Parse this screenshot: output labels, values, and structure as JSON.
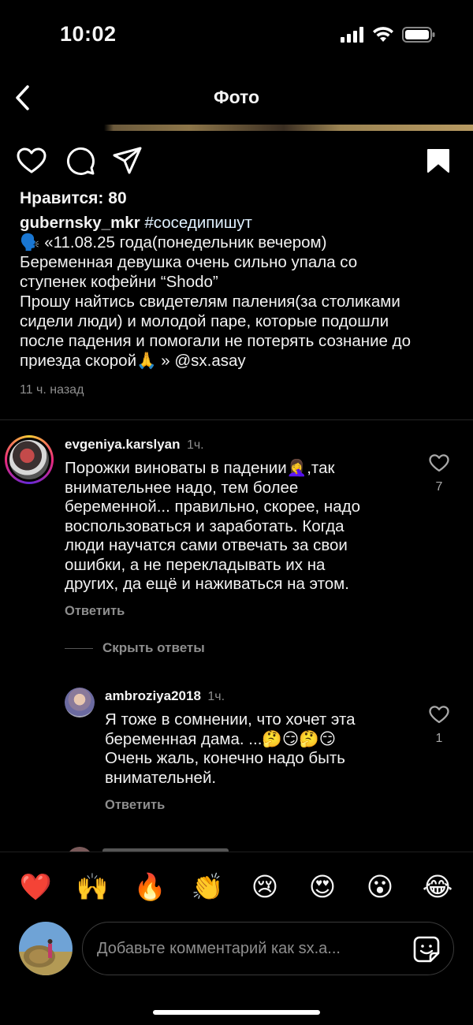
{
  "status_bar": {
    "time": "10:02"
  },
  "nav": {
    "title": "Фото"
  },
  "post": {
    "likes_text": "Нравится: 80",
    "caption": {
      "username": "gubernsky_mkr",
      "hashtag": "#соседипишут",
      "lines": [
        "🗣️ «11.08.25 года(понедельник вечером)",
        "Беременная девушка очень сильно упала со",
        "ступенек кофейни “Shodo”",
        "Прошу найтись свидетелям паления(за столиками",
        "сидели люди) и молодой паре, которые подошли",
        "после падения и помогали не потерять сознание до",
        "приезда скорой🙏 » @sx.asay"
      ]
    },
    "time_ago": "11 ч. назад"
  },
  "comments": [
    {
      "username": "evgeniya.karslyan",
      "time": "1ч.",
      "lines": [
        "Порожки  виноваты в падении🤦‍♀️,так",
        "внимательнее надо, тем более",
        "беременной... правильно, скорее, надо",
        "воспользоваться и заработать. Когда",
        "люди научатся сами отвечать за свои",
        "ошибки, а не перекладывать их на",
        "других, да ещё и наживаться на этом."
      ],
      "likes": "7",
      "reply_label": "Ответить"
    },
    {
      "username": "ambroziya2018",
      "time": "1ч.",
      "lines": [
        "Я тоже в сомнении, что хочет эта",
        "беременная дама. ...🤔😏🤔😏",
        "Очень жаль, конечно надо быть",
        "внимательней."
      ],
      "likes": "1",
      "reply_label": "Ответить"
    }
  ],
  "hide_replies_label": "Скрыть ответы",
  "emoji_bar": [
    "❤️",
    "🙌",
    "🔥",
    "👏",
    "😢",
    "😍",
    "😮",
    "😂"
  ],
  "comment_input": {
    "placeholder": "Добавьте комментарий как sx.a..."
  },
  "colors": {
    "background": "#000000",
    "muted": "#8e8e8e",
    "text": "#f5f5f5"
  }
}
